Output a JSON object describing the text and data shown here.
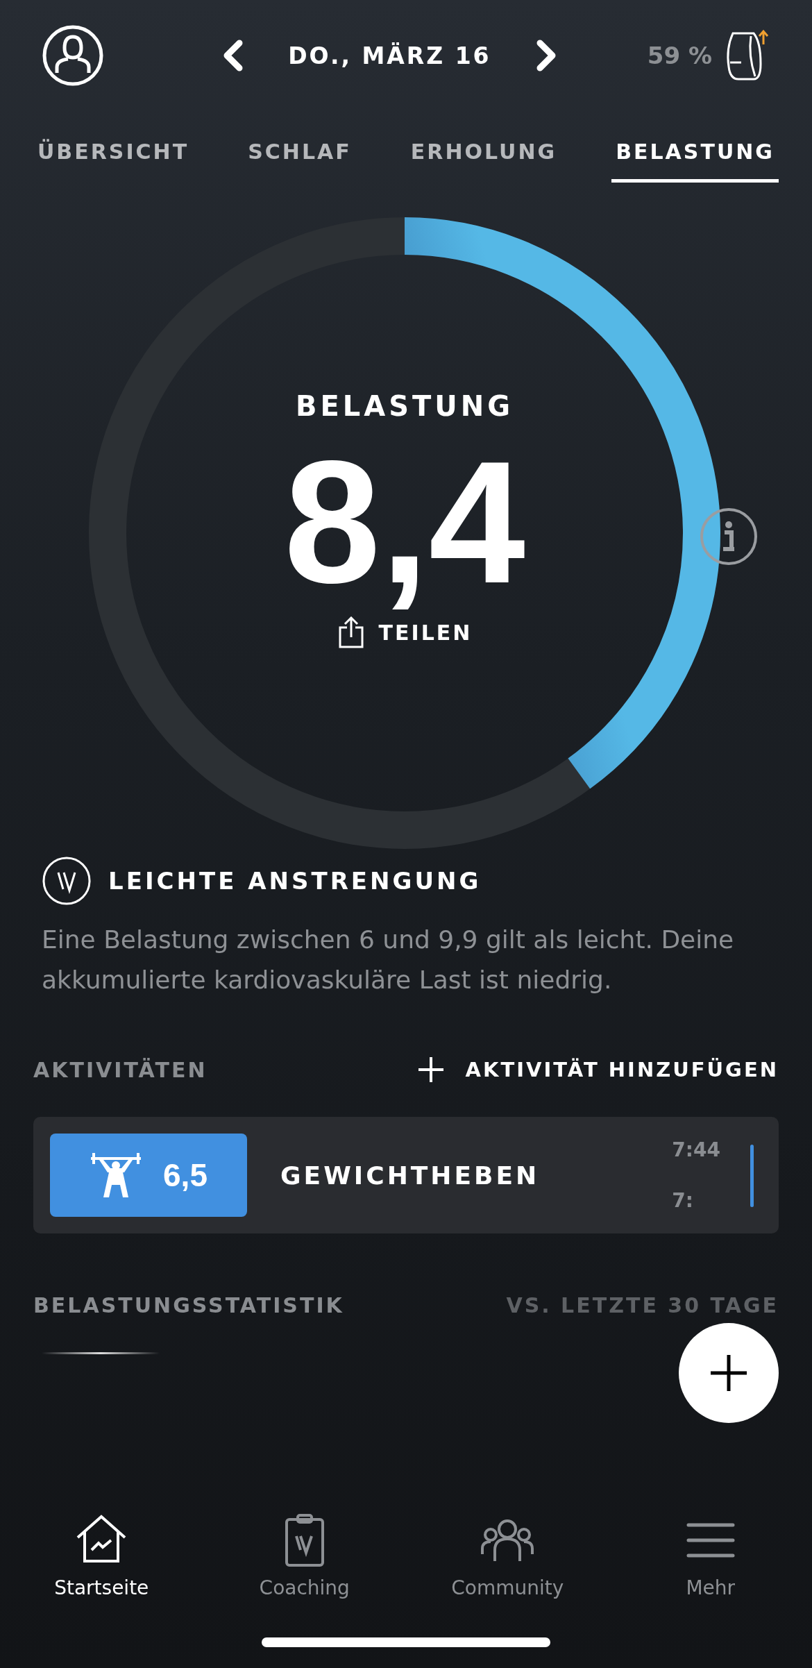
{
  "header": {
    "date": "DO., MÄRZ 16",
    "battery": "59 %"
  },
  "tabs": [
    {
      "label": "ÜBERSICHT",
      "selected": false
    },
    {
      "label": "SCHLAF",
      "selected": false
    },
    {
      "label": "ERHOLUNG",
      "selected": false
    },
    {
      "label": "BELASTUNG",
      "selected": true
    }
  ],
  "gauge": {
    "title": "BELASTUNG",
    "value": "8,4",
    "level": 0.4,
    "share": "TEILEN"
  },
  "level_info": {
    "title": "LEICHTE ANSTRENGUNG",
    "description": "Eine Belastung zwischen 6 und 9,9 gilt als leicht. Deine akkumulierte kardiovaskuläre Last ist niedrig."
  },
  "activities": {
    "title": "AKTIVITÄTEN",
    "add": "AKTIVITÄT HINZUFÜGEN",
    "items": [
      {
        "score": "6,5",
        "name": "GEWICHTHEBEN",
        "start": "7:44",
        "end": "7:"
      }
    ]
  },
  "stats": {
    "title": "BELASTUNGSSTATISTIK",
    "compare": "VS. LETZTE 30 TAGE"
  },
  "nav": [
    {
      "label": "Startseite",
      "selected": true
    },
    {
      "label": "Coaching",
      "selected": false
    },
    {
      "label": "Community",
      "selected": false
    },
    {
      "label": "Mehr",
      "selected": false
    }
  ]
}
